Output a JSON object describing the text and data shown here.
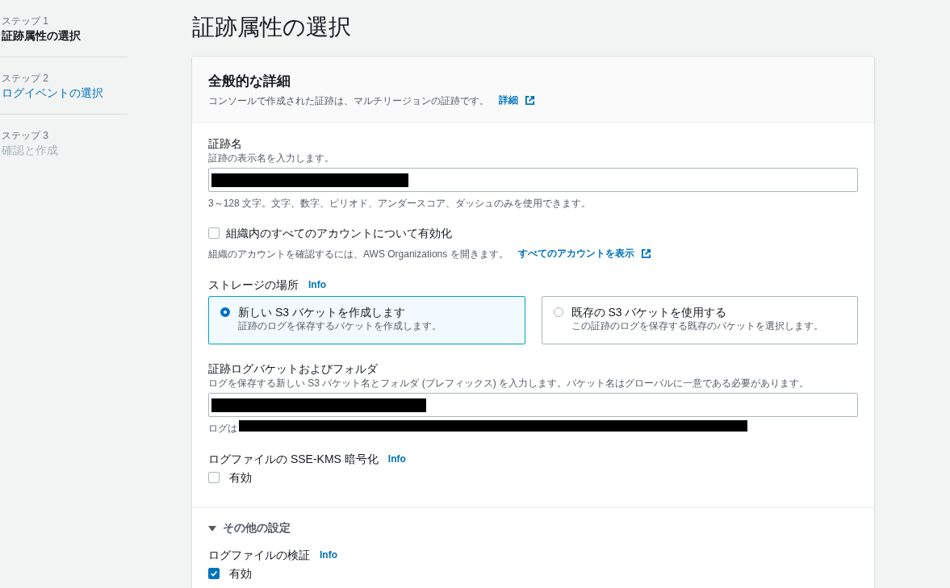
{
  "steps": [
    {
      "label": "ステップ 1",
      "title": "証跡属性の選択",
      "kind": "current"
    },
    {
      "label": "ステップ 2",
      "title": "ログイベントの選択",
      "kind": "link"
    },
    {
      "label": "ステップ 3",
      "title": "確認と作成",
      "kind": "disabled"
    }
  ],
  "page_title": "証跡属性の選択",
  "panel": {
    "title": "全般的な詳細",
    "description": "コンソールで作成された証跡は、マルチリージョンの証跡です。",
    "link": "詳細"
  },
  "trail_name": {
    "label": "証跡名",
    "description": "証跡の表示名を入力します。",
    "value_redacted": true,
    "constraint": "3～128 文字。文字、数字、ピリオド、アンダースコア、ダッシュのみを使用できます。"
  },
  "organization": {
    "label": "組織内のすべてのアカウントについて有効化",
    "checked": false,
    "hint": "組織のアカウントを確認するには、AWS Organizations を開きます。",
    "link": "すべてのアカウントを表示"
  },
  "storage": {
    "label": "ストレージの場所",
    "info": "Info",
    "options": [
      {
        "title": "新しい S3 バケットを作成します",
        "description": "証跡のログを保存するバケットを作成します。",
        "selected": true
      },
      {
        "title": "既存の S3 バケットを使用する",
        "description": "この証跡のログを保存する既存のバケットを選択します。",
        "selected": false
      }
    ]
  },
  "bucket": {
    "label": "証跡ログバケットおよびフォルダ",
    "description": "ログを保存する新しい S3 バケット名とフォルダ (プレフィックス) を入力します。バケット名はグローバルに一意である必要があります。",
    "value_redacted": true,
    "hint": "ログは",
    "hint_redacted": true
  },
  "sse_kms": {
    "label": "ログファイルの SSE-KMS 暗号化",
    "info": "Info",
    "option": "有効",
    "checked": false
  },
  "additional": {
    "title": "その他の設定",
    "expanded": true,
    "validation": {
      "label": "ログファイルの検証",
      "info": "Info",
      "option": "有効",
      "checked": true
    }
  }
}
